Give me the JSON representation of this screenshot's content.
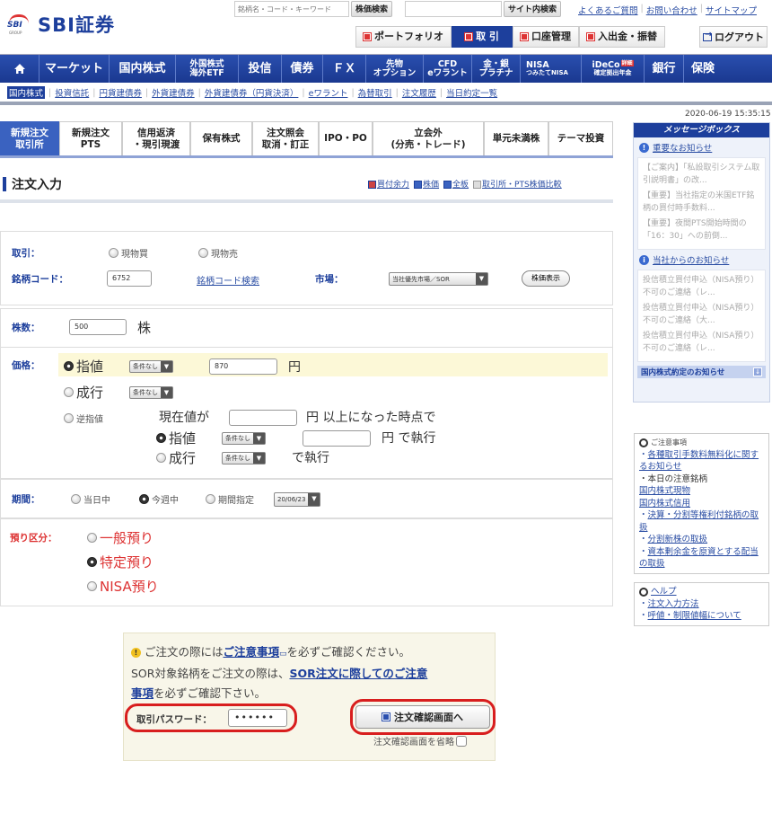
{
  "header": {
    "brand": "SBI証券",
    "logo_mark": "SBI",
    "logo_group": "GROUP",
    "search_placeholder": "銘柄名・コード・キーワード",
    "stock_search_button": "株価検索",
    "site_search_value": "",
    "site_search_button": "サイト内検索",
    "links": [
      "よくあるご質問",
      "お問い合わせ",
      "サイトマップ"
    ],
    "top_nav": [
      {
        "label": "ポートフォリオ",
        "active": false
      },
      {
        "label": "取 引",
        "active": true
      },
      {
        "label": "口座管理",
        "active": false
      },
      {
        "label": "入出金・振替",
        "active": false
      }
    ],
    "logout": "ログアウト"
  },
  "main_nav": [
    {
      "label": "home",
      "icon": "home-icon"
    },
    {
      "label": "マーケット"
    },
    {
      "label": "国内株式"
    },
    {
      "line1": "外国株式",
      "line2": "海外ETF"
    },
    {
      "label": "投信"
    },
    {
      "label": "債券"
    },
    {
      "label": "ＦＸ"
    },
    {
      "line1": "先物",
      "line2": "オプション"
    },
    {
      "line1": "CFD",
      "line2": "eワラント"
    },
    {
      "line1": "金・銀",
      "line2": "プラチナ"
    },
    {
      "line1": "NISA",
      "line2": "つみたてNISA"
    },
    {
      "line1": "iDeCo",
      "line2": "確定拠出年金",
      "badge": "詳細"
    },
    {
      "label": "銀行"
    },
    {
      "label": "保険"
    }
  ],
  "sub_nav": [
    "国内株式",
    "投資信託",
    "円貨建債券",
    "外貨建債券",
    "外貨建債券（円貨決済）",
    "eワラント",
    "為替取引",
    "注文履歴",
    "当日約定一覧"
  ],
  "timestamp": "2020-06-19 15:35:15",
  "tabs": [
    {
      "line1": "新規注文",
      "line2": "取引所",
      "active": true
    },
    {
      "line1": "新規注文",
      "line2": "PTS"
    },
    {
      "line1": "信用返済",
      "line2": "・現引現渡"
    },
    {
      "line1": "保有株式",
      "line2": ""
    },
    {
      "line1": "注文照会",
      "line2": "取消・訂正"
    },
    {
      "line1": "IPO・PO",
      "line2": ""
    },
    {
      "line1": "立会外",
      "line2": "(分売・トレード)"
    },
    {
      "line1": "単元未満株",
      "line2": ""
    },
    {
      "line1": "テーマ投資",
      "line2": ""
    }
  ],
  "page": {
    "title": "注文入力",
    "title_links": [
      "買付余力",
      "株価",
      "全板",
      "取引所・PTS株価比較"
    ]
  },
  "form": {
    "trade_label": "取引：",
    "trade_options": [
      {
        "label": "現物買",
        "selected": false
      },
      {
        "label": "現物売",
        "selected": false
      }
    ],
    "code_label": "銘柄コード：",
    "code_value": "6752",
    "code_search_link": "銘柄コード検索",
    "market_label": "市場：",
    "market_value": "当社優先市場／SOR",
    "show_price_button": "株価表示",
    "qty_label": "株数：",
    "qty_value": "500",
    "qty_unit": "株",
    "price_label": "価格：",
    "limit_label": "指値",
    "limit_selected": true,
    "condition_none": "条件なし",
    "limit_price_value": "870",
    "yen": "円",
    "market_order_label": "成行",
    "stop_label": "逆指値",
    "stop_line1_prefix": "現在値が",
    "stop_line1_suffix": "円 以上になった時点で",
    "stop_limit_label": "指値",
    "stop_limit_suffix": "円  で執行",
    "stop_market_label": "成行",
    "stop_market_suffix": "で執行",
    "period_label": "期間：",
    "period_options": [
      {
        "label": "当日中",
        "selected": false
      },
      {
        "label": "今週中",
        "selected": true
      },
      {
        "label": "期間指定",
        "selected": false
      }
    ],
    "period_date": "20/06/23",
    "deposit_label": "預り区分：",
    "deposit_options": [
      {
        "label": "一般預り",
        "selected": false
      },
      {
        "label": "特定預り",
        "selected": true
      },
      {
        "label": "NISA預り",
        "selected": false
      }
    ]
  },
  "sidebar": {
    "message_box_title": "メッセージボックス",
    "important_title": "重要なお知らせ",
    "important_items": [
      "【ご案内】「私設取引システム取引説明書」の改...",
      "【重要】当社指定の米国ETF銘柄の買付時手数料...",
      "【重要】夜間PTS開始時間の「16：30」への前倒..."
    ],
    "company_title": "当社からのお知らせ",
    "company_items": [
      "投信積立買付申込（NISA預り）不可のご連絡（レ...",
      "投信積立買付申込（NISA預り）不可のご連絡（大...",
      "投信積立買付申込（NISA預り）不可のご連絡（レ..."
    ],
    "footer": "国内株式約定のお知らせ",
    "notes_title": "ご注意事項",
    "notes": [
      {
        "text": "各種取引手数料無料化に関するお知らせ",
        "link": true,
        "bullet": true
      },
      {
        "text": "本日の注意銘柄",
        "link": false,
        "bullet": true
      },
      {
        "text": "国内株式現物",
        "link": true,
        "bullet": false
      },
      {
        "text": "国内株式信用",
        "link": true,
        "bullet": false
      },
      {
        "text": "決算・分割等権利付銘柄の取扱",
        "link": true,
        "bullet": true
      },
      {
        "text": "分割新株の取扱",
        "link": true,
        "bullet": true
      },
      {
        "text": "資本剰余金を原資とする配当の取扱",
        "link": true,
        "bullet": true
      }
    ],
    "help_title": "ヘルプ",
    "help_items": [
      "注文入力方法",
      "呼値・制限値幅について"
    ]
  },
  "confirm": {
    "line1_prefix": "ご注文の際には",
    "line1_link": "ご注意事項",
    "line1_suffix": "を必ずご確認ください。",
    "line2_prefix": "SOR対象銘柄をご注文の際は、",
    "line2_link_a": "SOR注文に際してのご注意",
    "line2_link_b": "事項",
    "line2_suffix": "を必ずご確認下さい。",
    "password_label": "取引パスワード：",
    "password_value": "••••••",
    "confirm_button": "注文確認画面へ",
    "skip_label": "注文確認画面を省略",
    "skip_checked": false,
    "highlight_color": "#d81e1e"
  }
}
